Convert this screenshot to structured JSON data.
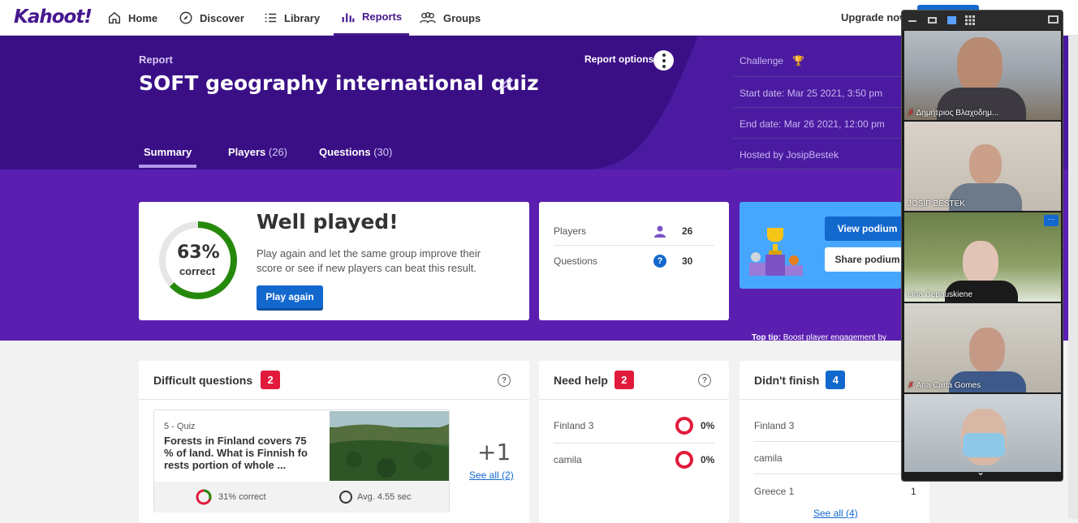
{
  "nav": {
    "logo": "Kahoot!",
    "items": [
      {
        "label": "Home",
        "icon": "home-icon"
      },
      {
        "label": "Discover",
        "icon": "compass-icon"
      },
      {
        "label": "Library",
        "icon": "list-icon"
      },
      {
        "label": "Reports",
        "icon": "bar-chart-icon"
      },
      {
        "label": "Groups",
        "icon": "groups-icon"
      }
    ],
    "active": "Reports",
    "upgrade": "Upgrade now"
  },
  "report": {
    "label": "Report",
    "title": "SOFT geography international quiz",
    "options": "Report options",
    "tabs": [
      {
        "label": "Summary",
        "count": ""
      },
      {
        "label": "Players",
        "count": "(26)"
      },
      {
        "label": "Questions",
        "count": "(30)"
      }
    ],
    "side": {
      "challenge": "Challenge",
      "start": "Start date: Mar 25 2021, 3:50 pm",
      "end": "End date: Mar 26 2021, 12:00 pm",
      "host": "Hosted by JosipBestek"
    }
  },
  "summary": {
    "percent": "63%",
    "percent_value": 0.63,
    "correct": "correct",
    "heading": "Well played!",
    "description": "Play again and let the same group improve their score or see if new players can beat this result.",
    "play_again": "Play again"
  },
  "stats": {
    "players_label": "Players",
    "players_value": "26",
    "questions_label": "Questions",
    "questions_value": "30"
  },
  "podium": {
    "view": "View podium",
    "share": "Share podium",
    "tip_bold": "Top tip:",
    "tip": " Boost player engagement by sharing the podium."
  },
  "difficult": {
    "title": "Difficult questions",
    "count": "2",
    "question_type": "5 - Quiz",
    "question_text": "Forests in Finland covers 75 % of land. What is Finnish forests portion of whole ...",
    "correct_pct": "31%",
    "correct_pct_value": 0.31,
    "correct_label": "correct",
    "avg_time": "Avg. 4.55 sec",
    "more": "+1",
    "see_all": "See all (2)"
  },
  "need_help": {
    "title": "Need help",
    "count": "2",
    "rows": [
      {
        "name": "Finland 3",
        "pct": "0%"
      },
      {
        "name": "camila",
        "pct": "0%"
      }
    ]
  },
  "didnt_finish": {
    "title": "Didn't finish",
    "count": "4",
    "rows": [
      {
        "name": "Finland 3",
        "value": ""
      },
      {
        "name": "camila",
        "value": ""
      },
      {
        "name": "Greece 1",
        "value": "1"
      }
    ],
    "see_all": "See all (4)"
  },
  "video": {
    "participants": [
      {
        "name": "Δημήτριος Βλαχοδημ...",
        "muted": true
      },
      {
        "name": "JOSIP BEŠTEK",
        "muted": false
      },
      {
        "name": "Lina Cepauskiene",
        "muted": false
      },
      {
        "name": "Ana Carla Gomes",
        "muted": true
      },
      {
        "name": "",
        "muted": false
      }
    ]
  },
  "colors": {
    "purple_dark": "#3a0f86",
    "purple": "#5a1fb0",
    "blue": "#1368ce",
    "red": "#e21b3c",
    "green": "#26890c"
  }
}
